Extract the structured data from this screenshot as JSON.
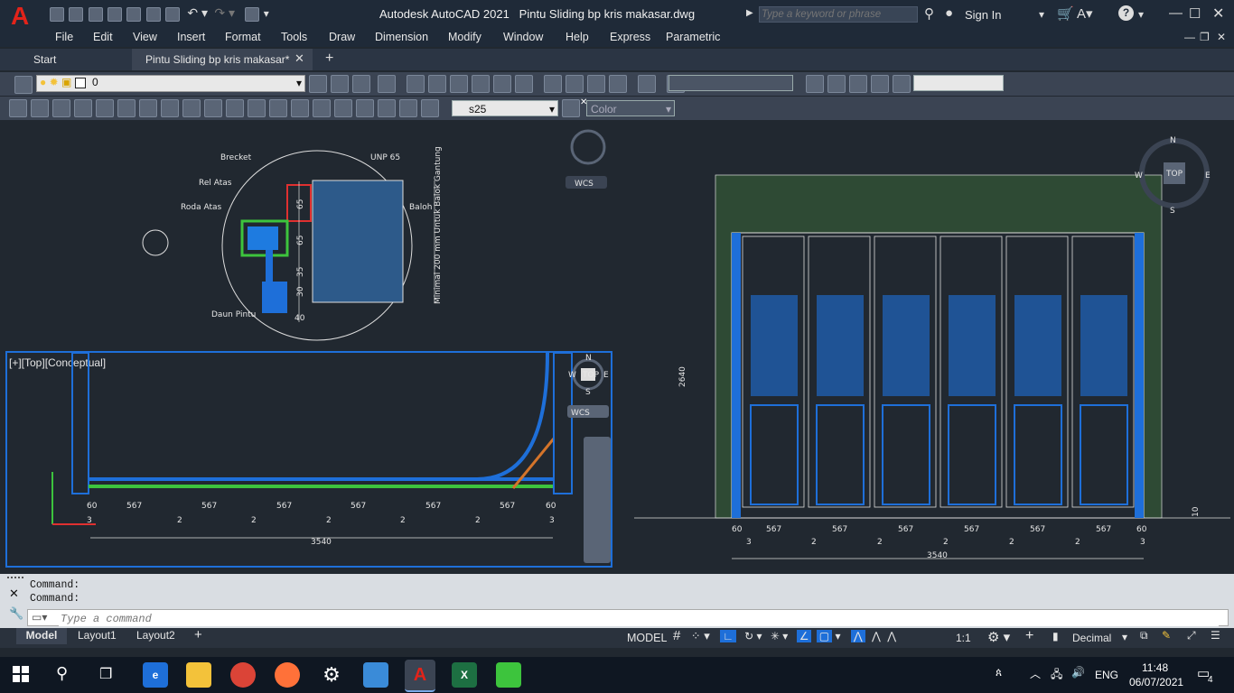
{
  "app": {
    "title": "Autodesk AutoCAD 2021",
    "document": "Pintu Sliding bp kris makasar.dwg",
    "search_placeholder": "Type a keyword or phrase",
    "sign_in": "Sign In"
  },
  "menu": [
    "File",
    "Edit",
    "View",
    "Insert",
    "Format",
    "Tools",
    "Draw",
    "Dimension",
    "Modify",
    "Window",
    "Help",
    "Express",
    "Parametric"
  ],
  "tabs": [
    {
      "label": "Start"
    },
    {
      "label": "Pintu Sliding bp kris makasar*"
    }
  ],
  "toolbar": {
    "layer_value": "0",
    "dimstyle_value": "s25",
    "color_value": "Color"
  },
  "viewports": {
    "top_left": {
      "labels": [
        "Brecket",
        "UNP 65",
        "Rel Atas",
        "Roda Atas",
        "Daun Pintu",
        "Baloh",
        "Minimal 200 mm Untuk Balok Gantung"
      ],
      "dims": [
        "65",
        "65",
        "35",
        "30",
        "40"
      ],
      "compass_wcs": "WCS"
    },
    "bottom_left": {
      "caption": "[+][Top][Conceptual]",
      "dims_top": [
        "60",
        "567",
        "567",
        "567",
        "567",
        "567",
        "567",
        "60"
      ],
      "dims_small": [
        "3",
        "2",
        "2",
        "2",
        "2",
        "2",
        "3"
      ],
      "total": "3540",
      "compass": {
        "n": "N",
        "s": "S",
        "w": "W",
        "e": "E",
        "top": "TOP",
        "wcs": "WCS"
      }
    },
    "right": {
      "compass": {
        "n": "N",
        "s": "S",
        "w": "W",
        "e": "E",
        "top": "TOP"
      },
      "height_dim": "2640",
      "right_dim": "10",
      "dims_top": [
        "60",
        "567",
        "567",
        "567",
        "567",
        "567",
        "567",
        "60"
      ],
      "dims_small": [
        "3",
        "2",
        "2",
        "2",
        "2",
        "2",
        "3"
      ],
      "total": "3540"
    }
  },
  "command": {
    "history": [
      "Command:",
      "Command:"
    ],
    "placeholder": "Type a command"
  },
  "layout_tabs": [
    "Model",
    "Layout1",
    "Layout2"
  ],
  "status": {
    "model": "MODEL",
    "scale": "1:1",
    "units": "Decimal"
  },
  "taskbar": {
    "language": "ENG",
    "time": "11:48",
    "date": "06/07/2021",
    "notifications": "4"
  },
  "colors": {
    "accent_blue": "#1e6fd9",
    "autocad_red": "#c8102e"
  }
}
